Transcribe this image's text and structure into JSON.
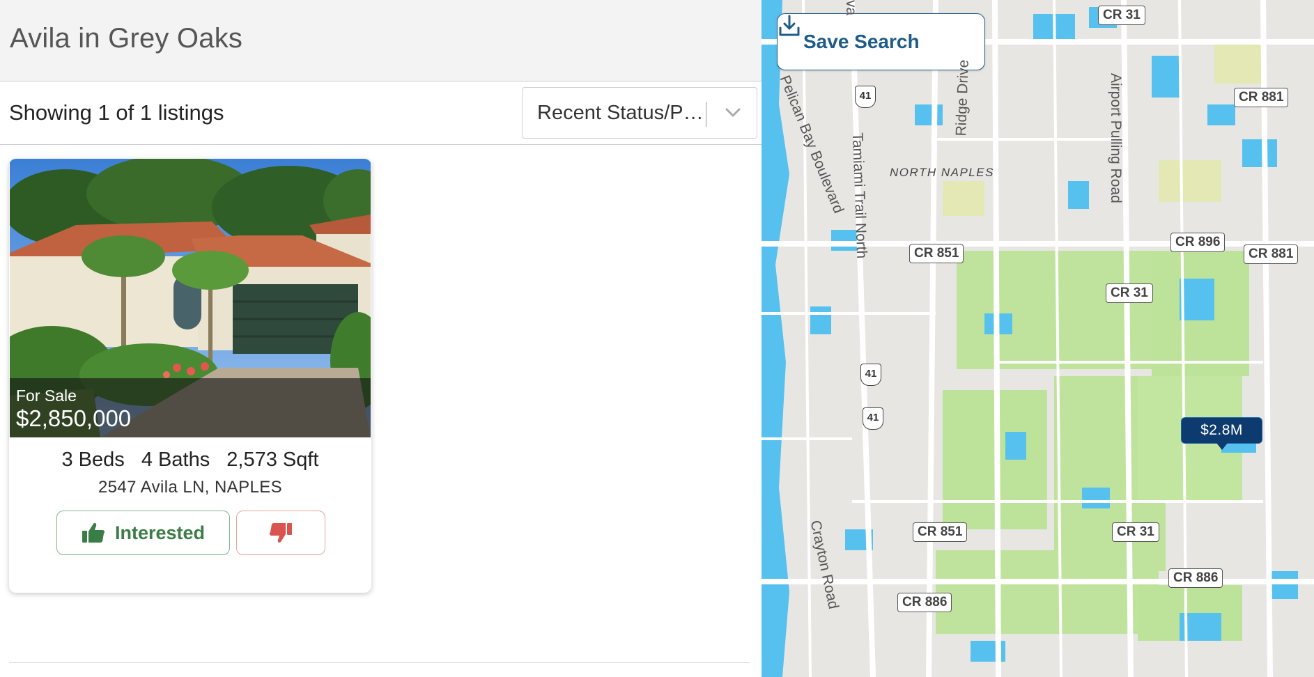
{
  "page": {
    "title": "Avila in Grey Oaks"
  },
  "toolbar": {
    "listing_count": "Showing 1 of 1 listings",
    "sort_value": "Recent Status/Price Change",
    "sort_icon": "chevron-down-icon"
  },
  "listing": {
    "status": "For Sale",
    "price": "$2,850,000",
    "beds": "3 Beds",
    "baths": "4 Baths",
    "sqft": "2,573 Sqft",
    "address": "2547 Avila LN, NAPLES",
    "interested_label": "Interested",
    "interested_icon": "thumbs-up-icon",
    "dislike_icon": "thumbs-down-icon"
  },
  "map": {
    "save_search_label": "Save Search",
    "save_icon": "download-icon",
    "marker_price": "$2.8M",
    "area_label": "NORTH NAPLES",
    "shields": [
      "CR 31",
      "CR 881",
      "CR 851",
      "CR 896",
      "CR 881",
      "CR 31",
      "CR 851",
      "CR 31",
      "CR 886",
      "CR 886"
    ],
    "us_routes": [
      "41",
      "41",
      "41"
    ],
    "road_names": [
      "Pelican Bay Boulevard",
      "Tamiami Trail North",
      "Ridge Drive",
      "Airport Pulling Road",
      "Crayton Road",
      "va"
    ]
  },
  "colors": {
    "brand_blue": "#1d5b88",
    "interested_green": "#3a7d46",
    "dislike_red": "#d9534f",
    "marker_navy": "#0d3a6f"
  }
}
